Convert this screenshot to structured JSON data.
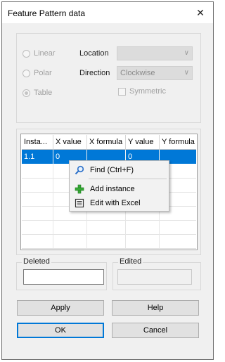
{
  "window": {
    "title": "Feature Pattern data",
    "close_glyph": "✕"
  },
  "pattern": {
    "radio_linear": "Linear",
    "radio_polar": "Polar",
    "radio_table": "Table",
    "selected_radio": "Table",
    "location_label": "Location",
    "location_value": "",
    "direction_label": "Direction",
    "direction_value": "Clockwise",
    "symmetric_label": "Symmetric",
    "symmetric_checked": false
  },
  "table": {
    "columns": [
      "Insta...",
      "X value",
      "X formula",
      "Y value",
      "Y formula"
    ],
    "rows": [
      {
        "instance": "1.1",
        "x_value": "0",
        "x_formula": "",
        "y_value": "0",
        "y_formula": ""
      }
    ]
  },
  "context_menu": {
    "items": [
      {
        "label": "Find (Ctrl+F)",
        "icon": "magnifier-icon"
      },
      {
        "label": "Add instance",
        "icon": "green-plus-icon"
      },
      {
        "label": "Edit with Excel",
        "icon": "spreadsheet-icon"
      }
    ]
  },
  "status": {
    "deleted_label": "Deleted",
    "deleted_value": "",
    "edited_label": "Edited",
    "edited_value": ""
  },
  "buttons": {
    "apply": "Apply",
    "help": "Help",
    "ok": "OK",
    "cancel": "Cancel"
  },
  "colors": {
    "selection": "#0078d7",
    "dialog_bg": "#f0f0f0",
    "disabled_text": "#a0a0a0"
  }
}
